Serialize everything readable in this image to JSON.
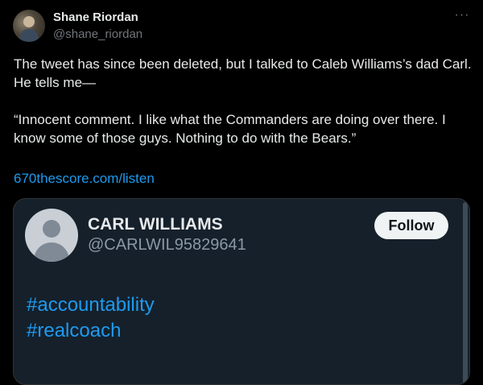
{
  "author": {
    "name": "Shane Riordan",
    "handle": "@shane_riordan"
  },
  "more_icon": "more-horizontal-icon",
  "tweet": {
    "paragraphs": [
      "The tweet has since been deleted, but I talked to Caleb Williams’s dad Carl. He tells me—",
      "“Innocent comment.  I like what the Commanders are doing over there.  I know some of those guys. Nothing to do with the Bears.”"
    ],
    "link": "670thescore.com/listen"
  },
  "embedded_tweet": {
    "name": "CARL WILLIAMS",
    "handle": "@CARLWIL95829641",
    "follow_label": "Follow",
    "hashtags": [
      "#accountability",
      "#realcoach"
    ]
  },
  "colors": {
    "background": "#000000",
    "text": "#e7e9ea",
    "muted": "#71767b",
    "link": "#1d9bf0",
    "embed_background": "#15202b"
  }
}
